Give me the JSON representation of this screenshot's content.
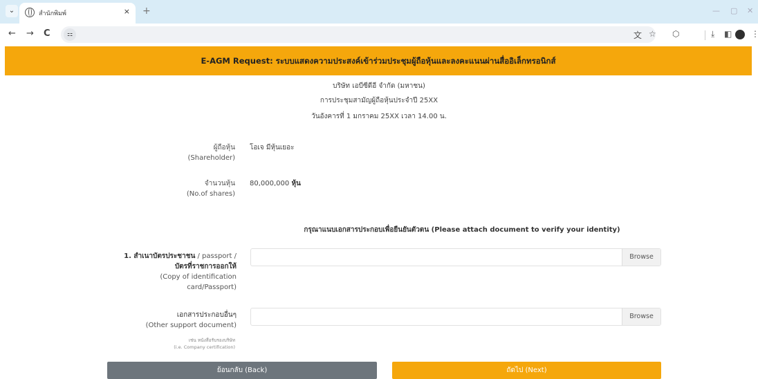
{
  "browser": {
    "tab_title": "สำนักพิมพ์",
    "tab_close": "×",
    "new_tab": "+",
    "tab_menu": "⌄",
    "minimize": "—",
    "maximize": "▢",
    "close": "✕",
    "site_info_icon": "⚏",
    "back_icon": "←",
    "forward_icon": "→",
    "reload_icon": "C"
  },
  "banner": {
    "title": "E-AGM Request: ระบบแสดงความประสงค์เข้าร่วมประชุมผู้ถือหุ้นและลงคะแนนผ่านสื่ออิเล็กทรอนิกส์"
  },
  "meeting": {
    "company": "บริษัท เอบีซีดีอี จำกัด (มหาชน)",
    "meeting_name": "การประชุมสามัญผู้ถือหุ้นประจำปี 25XX",
    "datetime": "วันอังคารที่ 1 มกราคม 25XX เวลา 14.00 น."
  },
  "shareholder": {
    "label_th": "ผู้ถือหุ้น",
    "label_en": "(Shareholder)",
    "value": "โอเจ มีหุ้นเยอะ"
  },
  "shares": {
    "label_th": "จำนวนหุ้น",
    "label_en": "(No.of shares)",
    "value_number": "80,000,000",
    "value_unit": "หุ้น"
  },
  "attach": {
    "heading": "กรุณาแนบเอกสารประกอบเพื่อยืนยันตัวตน (Please attach document to verify your identity)",
    "doc1": {
      "line1_bold": "1. สำเนาบัตรประชาชน",
      "line1_rest": " / passport /",
      "line2": "บัตรที่ราชการออกให้",
      "line3": "(Copy of identification",
      "line4": "card/Passport)",
      "browse": "Browse"
    },
    "doc2": {
      "line1": "เอกสารประกอบอื่นๆ",
      "line2": "(Other support document)",
      "hint1": "เช่น หนังสือรับรองบริษัท",
      "hint2": "(i.e. Company certification)",
      "browse": "Browse"
    }
  },
  "buttons": {
    "back": "ย้อนกลับ (Back)",
    "next": "ถัดไป (Next)"
  },
  "colors": {
    "accent": "#f5a70c",
    "back_button": "#6d757c",
    "browser_tabbar": "#d9ecf7"
  }
}
